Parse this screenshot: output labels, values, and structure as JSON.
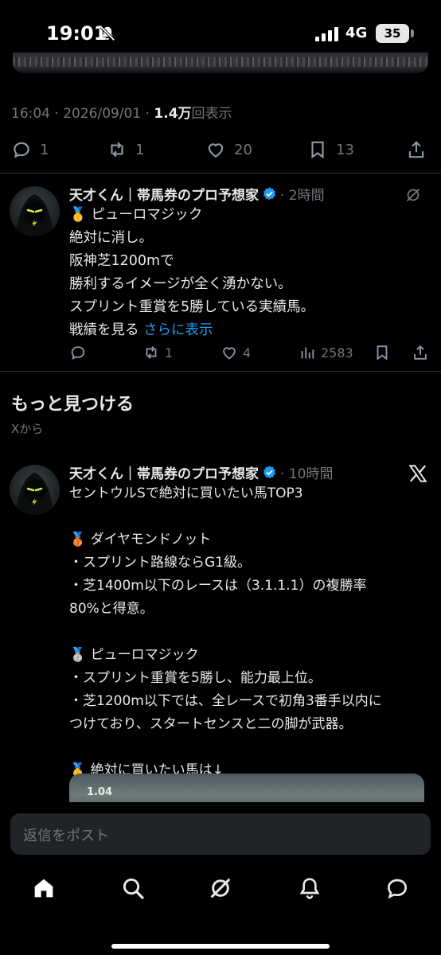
{
  "status_bar": {
    "time": "19:01",
    "network": "4G",
    "battery": "35"
  },
  "focused_tweet": {
    "timestamp": "16:04 · 2026/09/01 · ",
    "views_count": "1.4万",
    "views_label": "回表示",
    "replies": "1",
    "retweets": "1",
    "likes": "20",
    "bookmarks": "13"
  },
  "reply_tweet": {
    "name": "天才くん｜帯馬券のプロ予想家",
    "time": "· 2時間",
    "text": "🥇 ピューロマジック\n絶対に消し。\n阪神芝1200mで\n勝利するイメージが全く湧かない。\nスプリント重賞を5勝している実績馬。\n戦績を見る ",
    "show_more": "さらに表示",
    "replies": "",
    "retweets": "1",
    "likes": "4",
    "views": "2583"
  },
  "discover": {
    "title": "もっと見つける",
    "subtitle": "Xから"
  },
  "discover_tweet": {
    "name": "天才くん｜帯馬券のプロ予想家",
    "time": "· 10時間",
    "text": "セントウルSで絶対に買いたい馬TOP3\n\n🥉 ダイヤモンドノット\n・スプリント路線ならG1級。\n・芝1400m以下のレースは（3.1.1.1）の複勝率\n80%と得意。\n\n🥈 ピューロマジック\n・スプリント重賞を5勝し、能力最上位。\n・芝1200m以下では、全レースで初角3番手以内に\nつけており、スタートセンスと二の脚が武器。\n\n🥇 絶対に買いたい馬は↓",
    "media_label": "1.04"
  },
  "reply_bar": {
    "placeholder": "返信をポスト"
  },
  "colors": {
    "background": "#000000",
    "accent": "#1d9bf0",
    "muted": "#71767b",
    "text": "#e7e9ea",
    "divider": "#2f3336"
  },
  "icons": [
    "bell-off-icon",
    "signal-icon",
    "reply-icon",
    "retweet-icon",
    "like-icon",
    "bookmark-icon",
    "share-icon",
    "views-icon",
    "grok-icon",
    "x-logo-icon",
    "verified-icon",
    "home-icon",
    "search-icon",
    "notifications-icon",
    "messages-icon"
  ]
}
